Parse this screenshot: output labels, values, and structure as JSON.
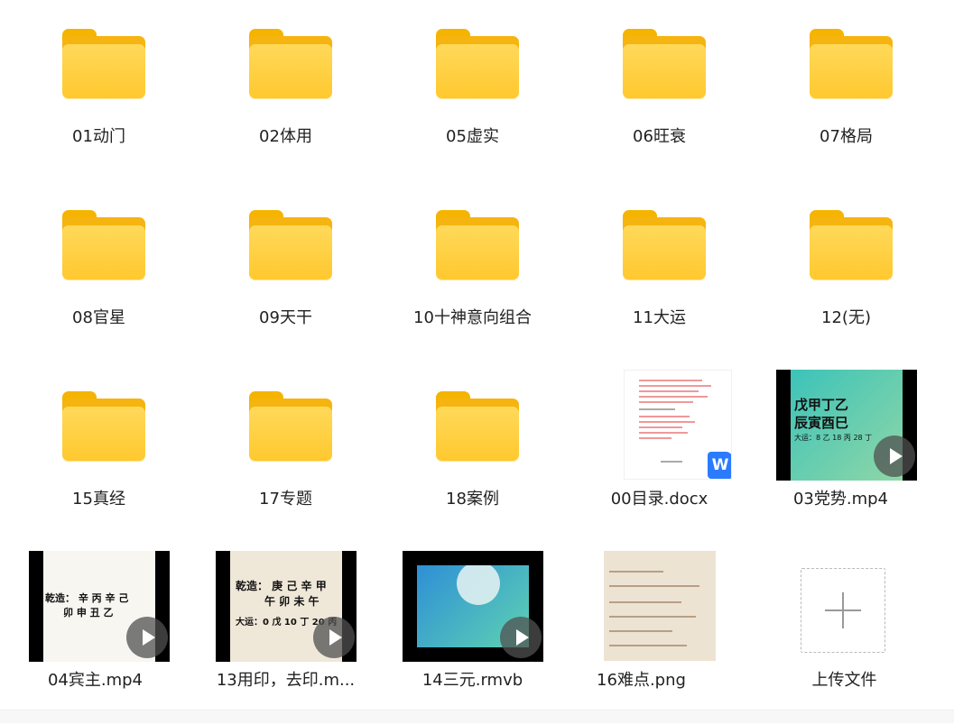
{
  "items": [
    {
      "label": "01动门",
      "type": "folder"
    },
    {
      "label": "02体用",
      "type": "folder"
    },
    {
      "label": "05虚实",
      "type": "folder"
    },
    {
      "label": "06旺衰",
      "type": "folder"
    },
    {
      "label": "07格局",
      "type": "folder"
    },
    {
      "label": "08官星",
      "type": "folder"
    },
    {
      "label": "09天干",
      "type": "folder"
    },
    {
      "label": "10十神意向组合",
      "type": "folder"
    },
    {
      "label": "11大运",
      "type": "folder"
    },
    {
      "label": "12(无)",
      "type": "folder"
    },
    {
      "label": "15真经",
      "type": "folder"
    },
    {
      "label": "17专题",
      "type": "folder"
    },
    {
      "label": "18案例",
      "type": "folder"
    },
    {
      "label": "00目录.docx",
      "type": "docx"
    },
    {
      "label": "03党势.mp4",
      "type": "video"
    },
    {
      "label": "04宾主.mp4",
      "type": "video"
    },
    {
      "label": "13用印，去印.m...",
      "type": "video"
    },
    {
      "label": "14三元.rmvb",
      "type": "video"
    },
    {
      "label": "16难点.png",
      "type": "png"
    },
    {
      "label": "上传文件",
      "type": "upload"
    }
  ],
  "thumbs": {
    "docx_badge": "W",
    "v03": {
      "l1": "戊甲丁乙",
      "l2": "辰寅酉巳",
      "l3": "大运：8 乙 18 丙 28 丁"
    },
    "v04": {
      "l1": "乾造： 辛 丙 辛 己",
      "l2": "卯 申 丑 乙"
    },
    "v13": {
      "l1": "乾造： 庚 己 辛 甲",
      "l2": "午 卯 未 午",
      "l3": "大运：0 戊 10 丁 20 丙"
    }
  },
  "colors": {
    "folder": "#FFC82E",
    "accent": "#2B7BFF"
  }
}
